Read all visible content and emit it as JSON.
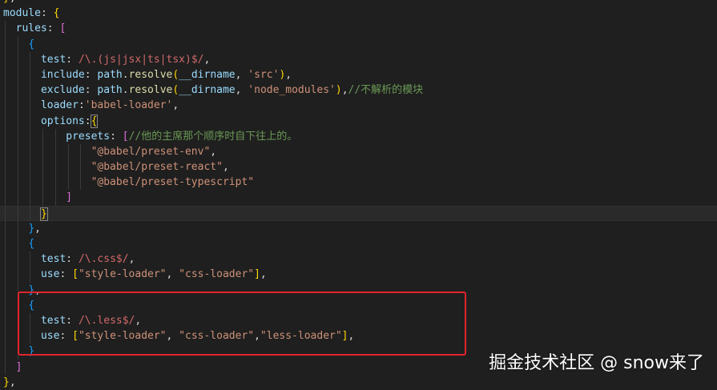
{
  "lines": [
    [
      [
        "tok-brk",
        "}"
      ],
      [
        "tok-pun",
        ","
      ]
    ],
    [
      [
        "tok-key",
        "module"
      ],
      [
        "tok-pun",
        ": "
      ],
      [
        "tok-brk",
        "{"
      ]
    ],
    [
      [
        "tok-pun",
        "  "
      ],
      [
        "tok-key",
        "rules"
      ],
      [
        "tok-pun",
        ": "
      ],
      [
        "tok-brk2",
        "["
      ]
    ],
    [
      [
        "tok-pun",
        "    "
      ],
      [
        "tok-brk3",
        "{"
      ]
    ],
    [
      [
        "tok-pun",
        "      "
      ],
      [
        "tok-key",
        "test"
      ],
      [
        "tok-pun",
        ": "
      ],
      [
        "tok-re",
        "/\\.(js|jsx|ts|tsx)$/"
      ],
      [
        "tok-pun",
        ","
      ]
    ],
    [
      [
        "tok-pun",
        "      "
      ],
      [
        "tok-key",
        "include"
      ],
      [
        "tok-pun",
        ": "
      ],
      [
        "tok-var",
        "path"
      ],
      [
        "tok-pun",
        "."
      ],
      [
        "tok-fn",
        "resolve"
      ],
      [
        "tok-brk",
        "("
      ],
      [
        "tok-var",
        "__dirname"
      ],
      [
        "tok-pun",
        ", "
      ],
      [
        "tok-str",
        "'src'"
      ],
      [
        "tok-brk",
        ")"
      ],
      [
        "tok-pun",
        ","
      ]
    ],
    [
      [
        "tok-pun",
        "      "
      ],
      [
        "tok-key",
        "exclude"
      ],
      [
        "tok-pun",
        ": "
      ],
      [
        "tok-var",
        "path"
      ],
      [
        "tok-pun",
        "."
      ],
      [
        "tok-fn",
        "resolve"
      ],
      [
        "tok-brk",
        "("
      ],
      [
        "tok-var",
        "__dirname"
      ],
      [
        "tok-pun",
        ", "
      ],
      [
        "tok-str",
        "'node_modules'"
      ],
      [
        "tok-brk",
        ")"
      ],
      [
        "tok-pun",
        ","
      ],
      [
        "tok-cmt",
        "//不解析的模块"
      ]
    ],
    [
      [
        "tok-pun",
        "      "
      ],
      [
        "tok-key",
        "loader"
      ],
      [
        "tok-pun",
        ":"
      ],
      [
        "tok-str",
        "'babel-loader'"
      ],
      [
        "tok-pun",
        ","
      ]
    ],
    [
      [
        "tok-pun",
        "      "
      ],
      [
        "tok-key",
        "options"
      ],
      [
        "tok-pun",
        ":"
      ],
      [
        "tok-brk",
        "{"
      ]
    ],
    [
      [
        "tok-pun",
        "          "
      ],
      [
        "tok-key",
        "presets"
      ],
      [
        "tok-pun",
        ": "
      ],
      [
        "tok-brk2",
        "["
      ],
      [
        "tok-cmt",
        "//他的主席那个顺序时自下往上的。"
      ]
    ],
    [
      [
        "tok-pun",
        "              "
      ],
      [
        "tok-str",
        "\"@babel/preset-env\""
      ],
      [
        "tok-pun",
        ","
      ]
    ],
    [
      [
        "tok-pun",
        "              "
      ],
      [
        "tok-str",
        "\"@babel/preset-react\""
      ],
      [
        "tok-pun",
        ","
      ]
    ],
    [
      [
        "tok-pun",
        "              "
      ],
      [
        "tok-str",
        "\"@babel/preset-typescript\""
      ]
    ],
    [
      [
        "tok-pun",
        "          "
      ],
      [
        "tok-brk2",
        "]"
      ]
    ],
    [
      [
        "tok-pun",
        "      "
      ],
      [
        "tok-brk",
        "}"
      ]
    ],
    [
      [
        "tok-pun",
        "    "
      ],
      [
        "tok-brk3",
        "}"
      ],
      [
        "tok-pun",
        ","
      ]
    ],
    [
      [
        "tok-pun",
        "    "
      ],
      [
        "tok-brk3",
        "{"
      ]
    ],
    [
      [
        "tok-pun",
        "      "
      ],
      [
        "tok-key",
        "test"
      ],
      [
        "tok-pun",
        ": "
      ],
      [
        "tok-re",
        "/\\.css$/"
      ],
      [
        "tok-pun",
        ","
      ]
    ],
    [
      [
        "tok-pun",
        "      "
      ],
      [
        "tok-key",
        "use"
      ],
      [
        "tok-pun",
        ": "
      ],
      [
        "tok-brk",
        "["
      ],
      [
        "tok-str",
        "\"style-loader\""
      ],
      [
        "tok-pun",
        ", "
      ],
      [
        "tok-str",
        "\"css-loader\""
      ],
      [
        "tok-brk",
        "]"
      ],
      [
        "tok-pun",
        ","
      ]
    ],
    [
      [
        "tok-pun",
        "    "
      ],
      [
        "tok-brk3",
        "}"
      ],
      [
        "tok-pun",
        ","
      ]
    ],
    [
      [
        "tok-pun",
        "    "
      ],
      [
        "tok-brk3",
        "{"
      ]
    ],
    [
      [
        "tok-pun",
        "      "
      ],
      [
        "tok-key",
        "test"
      ],
      [
        "tok-pun",
        ": "
      ],
      [
        "tok-re",
        "/\\.less$/"
      ],
      [
        "tok-pun",
        ","
      ]
    ],
    [
      [
        "tok-pun",
        "      "
      ],
      [
        "tok-key",
        "use"
      ],
      [
        "tok-pun",
        ": "
      ],
      [
        "tok-brk",
        "["
      ],
      [
        "tok-str",
        "\"style-loader\""
      ],
      [
        "tok-pun",
        ", "
      ],
      [
        "tok-str",
        "\"css-loader\""
      ],
      [
        "tok-pun",
        ","
      ],
      [
        "tok-str",
        "\"less-loader\""
      ],
      [
        "tok-brk",
        "]"
      ],
      [
        "tok-pun",
        ","
      ]
    ],
    [
      [
        "tok-pun",
        "    "
      ],
      [
        "tok-brk3",
        "}"
      ]
    ],
    [
      [
        "tok-pun",
        "  "
      ],
      [
        "tok-brk2",
        "]"
      ]
    ],
    [
      [
        "tok-brk",
        "}"
      ],
      [
        "tok-pun",
        ","
      ]
    ]
  ],
  "watermark": "掘金技术社区 @ snow来了"
}
